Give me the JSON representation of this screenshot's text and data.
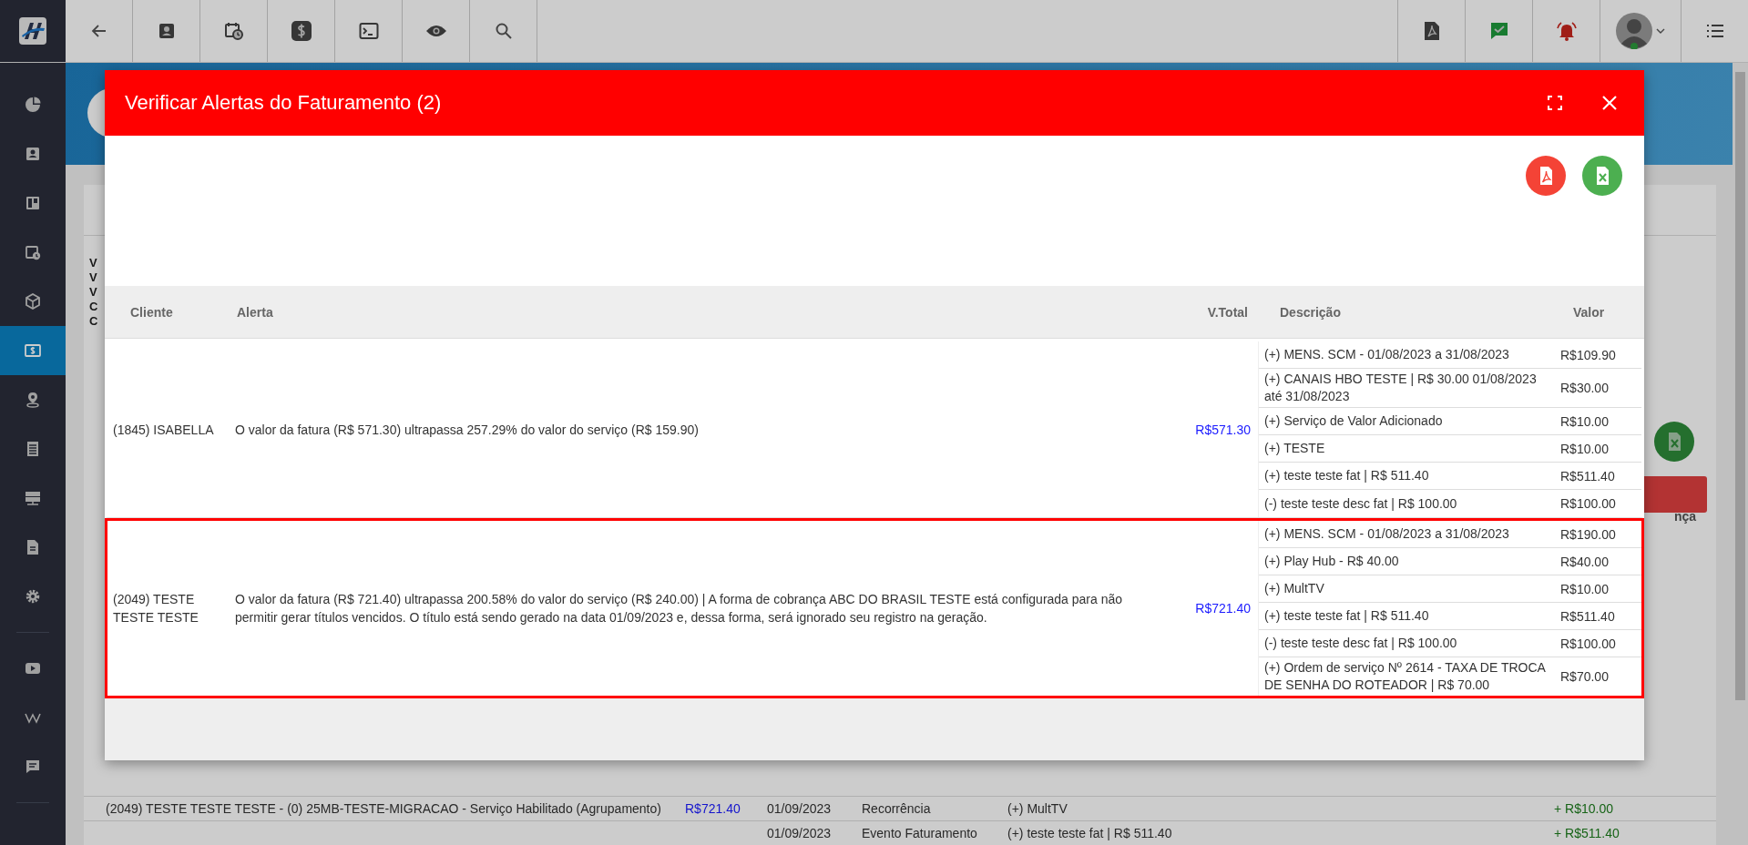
{
  "sidebar": {
    "items": [
      {
        "selected": false
      },
      {
        "selected": false
      },
      {
        "selected": false
      },
      {
        "selected": false
      },
      {
        "selected": false
      },
      {
        "selected": true
      },
      {
        "selected": false
      },
      {
        "selected": false
      },
      {
        "selected": false
      },
      {
        "selected": false
      },
      {
        "selected": false
      }
    ],
    "extra_items": [
      {
        "selected": false
      },
      {
        "selected": false
      },
      {
        "selected": false
      }
    ]
  },
  "background": {
    "label_fragments": [
      "V",
      "V",
      "V",
      "C",
      "C"
    ],
    "header_fragment": "nça",
    "rows": [
      {
        "cliente": "(2049) TESTE TESTE TESTE - (0) 25MB-TESTE-MIGRACAO - Serviço Habilitado (Agrupamento)",
        "total": "R$721.40",
        "date": "01/09/2023",
        "origin": "Recorrência",
        "description": "(+) MultTV",
        "value": "+ R$10.00"
      },
      {
        "cliente": "",
        "total": "",
        "date": "01/09/2023",
        "origin": "Evento Faturamento",
        "description": "(+) teste teste fat | R$ 511.40",
        "value": "+ R$511.40"
      }
    ]
  },
  "modal": {
    "title": "Verificar Alertas do Faturamento (2)",
    "columns": [
      "Cliente",
      "Alerta",
      "V.Total",
      "Descrição",
      "Valor"
    ],
    "rows": [
      {
        "highlighted": false,
        "cliente": "(1845) ISABELLA",
        "alerta": "O valor da fatura (R$ 571.30) ultrapassa 257.29% do valor do serviço (R$ 159.90)",
        "total": "R$571.30",
        "items": [
          {
            "descricao": "(+) MENS. SCM - 01/08/2023 a 31/08/2023",
            "valor": "R$109.90"
          },
          {
            "descricao": "(+) CANAIS HBO TESTE | R$ 30.00 01/08/2023 até 31/08/2023",
            "valor": "R$30.00"
          },
          {
            "descricao": "(+) Serviço de Valor Adicionado",
            "valor": "R$10.00"
          },
          {
            "descricao": "(+) TESTE",
            "valor": "R$10.00"
          },
          {
            "descricao": "(+) teste teste fat | R$ 511.40",
            "valor": "R$511.40"
          },
          {
            "descricao": "(-) teste teste desc fat | R$ 100.00",
            "valor": "R$100.00"
          }
        ]
      },
      {
        "highlighted": true,
        "cliente": "(2049) TESTE TESTE TESTE",
        "alerta": "O valor da fatura (R$ 721.40) ultrapassa 200.58% do valor do serviço (R$ 240.00) | A forma de cobrança ABC DO BRASIL TESTE está configurada para não permitir gerar títulos vencidos. O título está sendo gerado na data 01/09/2023 e, dessa forma, será ignorado seu registro na geração.",
        "total": "R$721.40",
        "items": [
          {
            "descricao": "(+) MENS. SCM - 01/08/2023 a 31/08/2023",
            "valor": "R$190.00"
          },
          {
            "descricao": "(+) Play Hub - R$ 40.00",
            "valor": "R$40.00"
          },
          {
            "descricao": "(+) MultTV",
            "valor": "R$10.00"
          },
          {
            "descricao": "(+) teste teste fat | R$ 511.40",
            "valor": "R$511.40"
          },
          {
            "descricao": "(-) teste teste desc fat | R$ 100.00",
            "valor": "R$100.00"
          },
          {
            "descricao": "(+) Ordem de serviço Nº 2614 - TAXA DE TROCA DE SENHA DO ROTEADOR | R$ 70.00",
            "valor": "R$70.00"
          }
        ]
      }
    ]
  }
}
